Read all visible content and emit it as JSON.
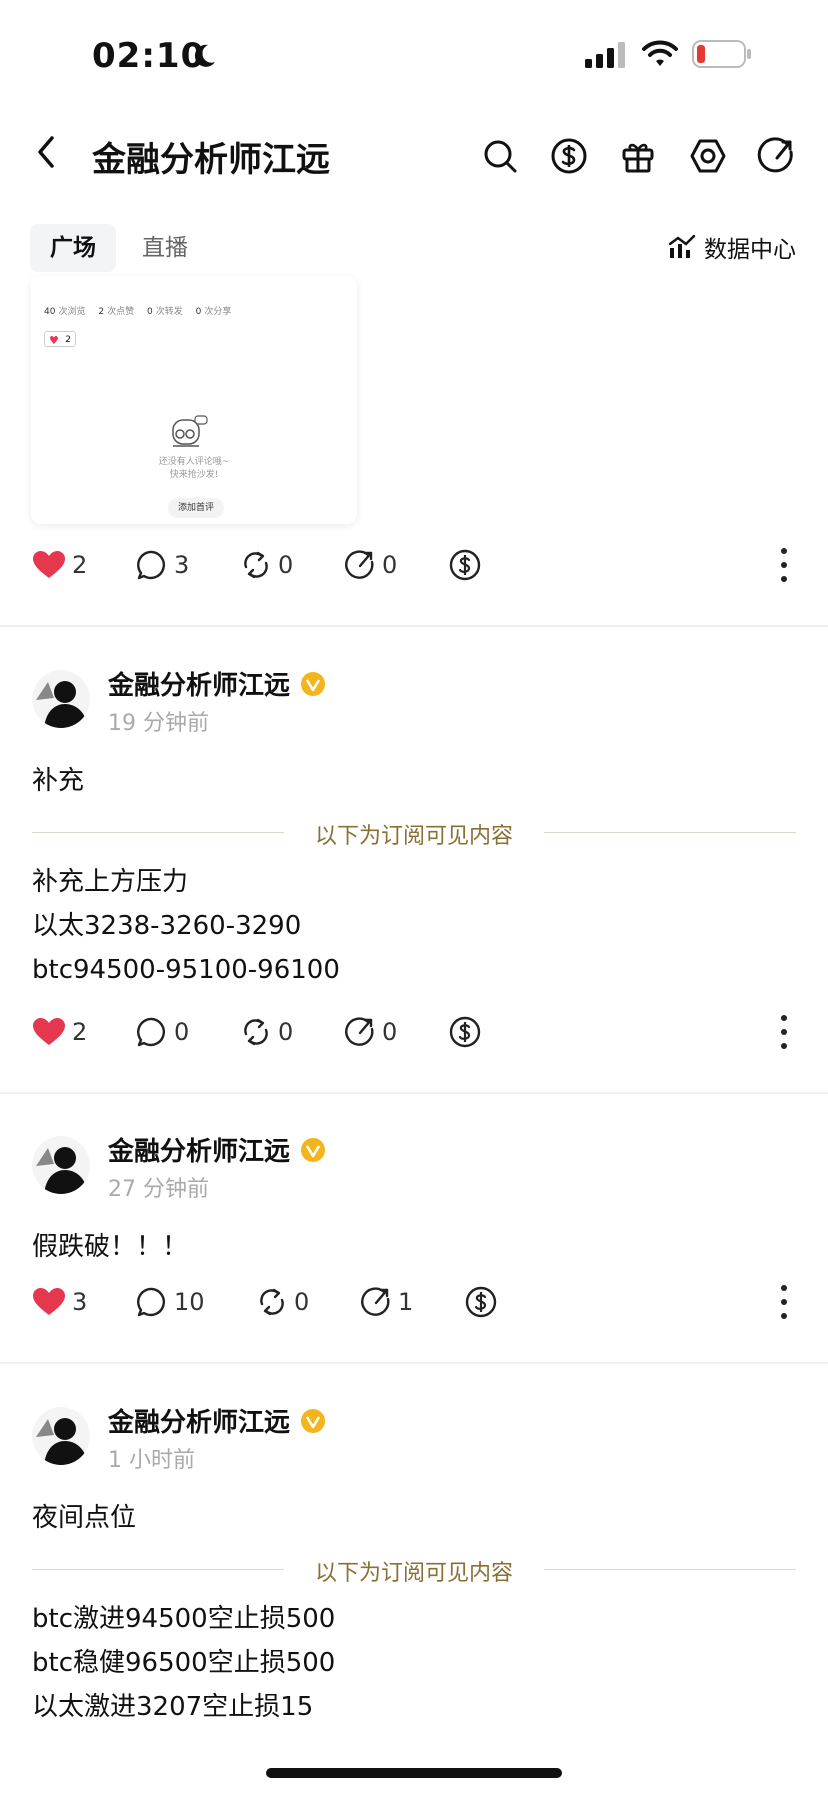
{
  "status_bar": {
    "time": "02:10"
  },
  "nav": {
    "title": "金融分析师江远"
  },
  "tabs": [
    {
      "label": "广场"
    },
    {
      "label": "直播"
    }
  ],
  "data_center_label": "数据中心",
  "preview_card": {
    "views": "40",
    "views_label": "次浏览",
    "likes": "2",
    "likes_label": "次点赞",
    "reposts": "0",
    "reposts_label": "次转发",
    "shares": "0",
    "shares_label": "次分享",
    "like_badge": "2",
    "empty_line1": "还没有人评论哦~",
    "empty_line2": "快来抢沙发!",
    "first_comment_button": "添加首评"
  },
  "top_actions": {
    "likes": "2",
    "comments": "3",
    "reposts": "0",
    "shares": "0"
  },
  "posts": [
    {
      "author": "金融分析师江远",
      "time_ago": "19 分钟前",
      "text": "补充",
      "subscriber_divider": "以下为订阅可见内容",
      "lines": [
        "补充上方压力",
        "以太3238-3260-3290",
        "btc94500-95100-96100"
      ],
      "actions": {
        "likes": "2",
        "comments": "0",
        "reposts": "0",
        "shares": "0"
      }
    },
    {
      "author": "金融分析师江远",
      "time_ago": "27 分钟前",
      "text": "假跌破！！！",
      "actions": {
        "likes": "3",
        "comments": "10",
        "reposts": "0",
        "shares": "1"
      }
    },
    {
      "author": "金融分析师江远",
      "time_ago": "1 小时前",
      "text": "夜间点位",
      "subscriber_divider": "以下为订阅可见内容",
      "lines": [
        "btc激进94500空止损500",
        "btc稳健96500空止损500",
        "以太激进3207空止损15"
      ]
    }
  ],
  "colors": {
    "like": "#e5374e",
    "verified": "#f3b51b",
    "subscriber_text": "#8a7034"
  }
}
